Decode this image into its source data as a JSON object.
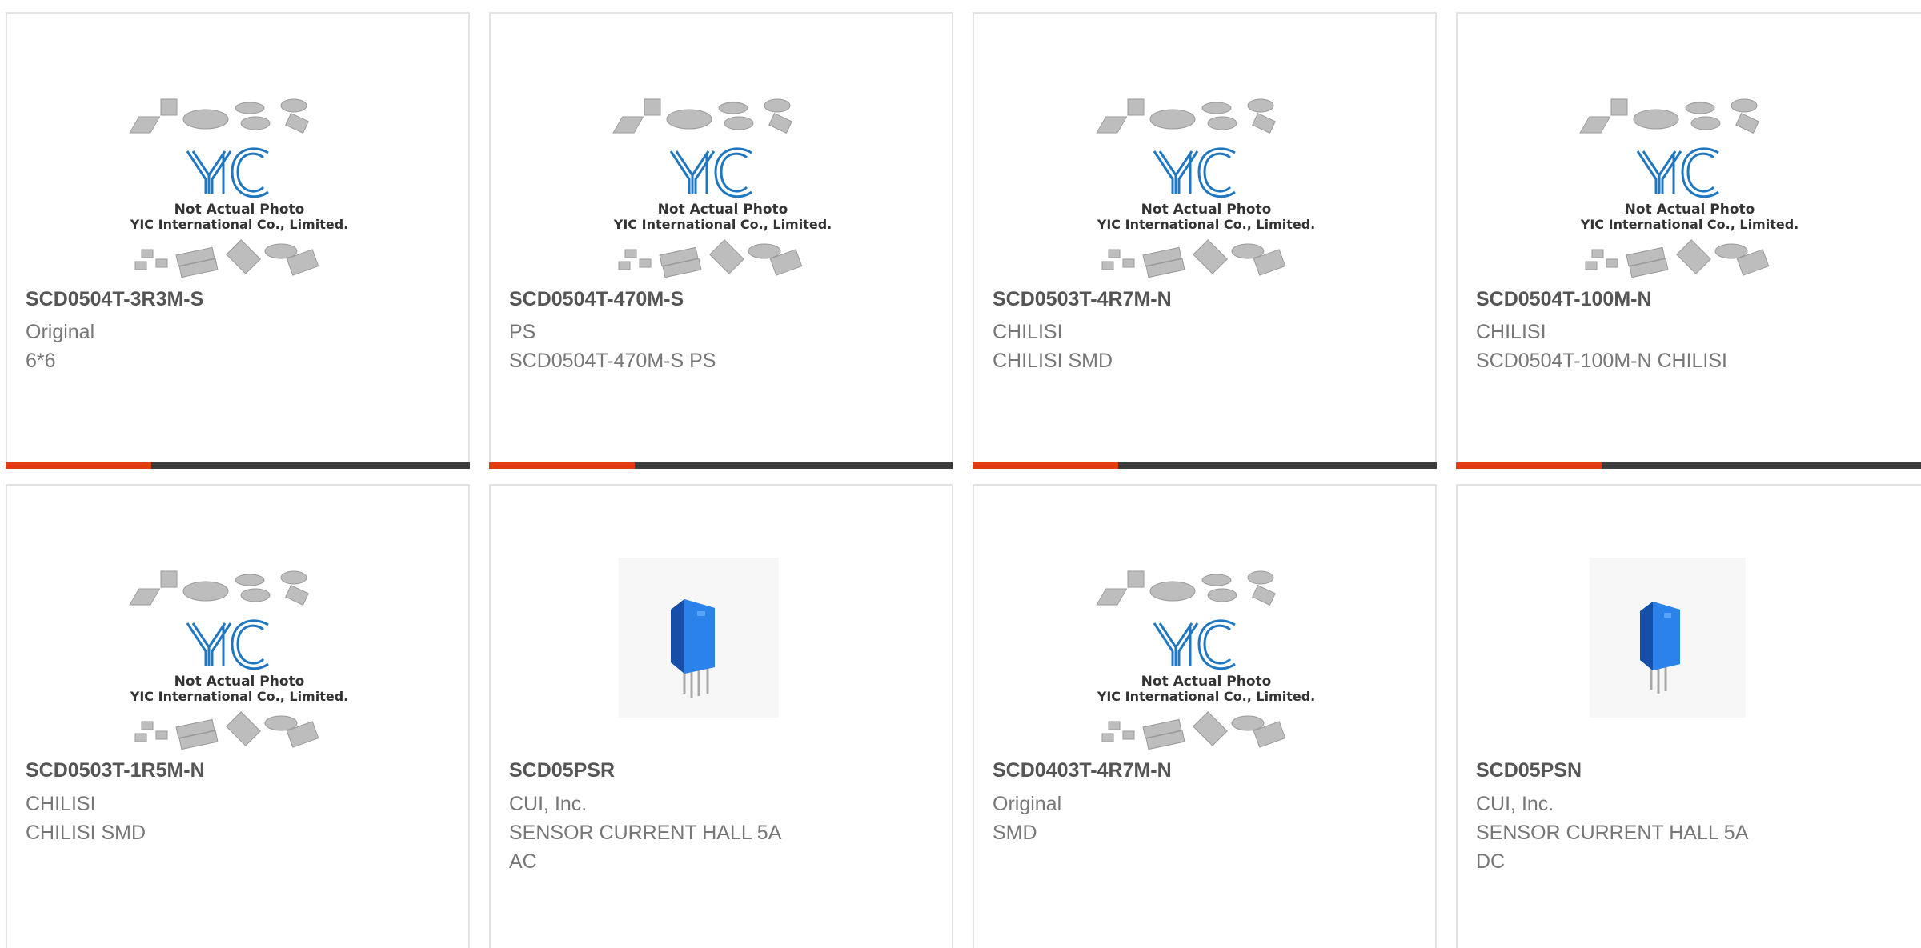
{
  "placeholder": {
    "line1": "Not Actual Photo",
    "line2": "YIC International Co., Limited."
  },
  "colors": {
    "accent_bar": "#e23c13",
    "dark_bar": "#3c3c3c",
    "logo_blue": "#1f77c2",
    "product_blue": "#1f6ed6"
  },
  "products": [
    {
      "part": "SCD0504T-3R3M-S",
      "brand": "Original",
      "desc": [
        "6*6"
      ],
      "image": "placeholder-logo-icon"
    },
    {
      "part": "SCD0504T-470M-S",
      "brand": "PS",
      "desc": [
        "SCD0504T-470M-S PS"
      ],
      "image": "placeholder-logo-icon"
    },
    {
      "part": "SCD0503T-4R7M-N",
      "brand": "CHILISI",
      "desc": [
        "CHILISI SMD"
      ],
      "image": "placeholder-logo-icon"
    },
    {
      "part": "SCD0504T-100M-N",
      "brand": "CHILISI",
      "desc": [
        "SCD0504T-100M-N CHILISI"
      ],
      "image": "placeholder-logo-icon"
    },
    {
      "part": "SCD0503T-1R5M-N",
      "brand": "CHILISI",
      "desc": [
        "CHILISI SMD"
      ],
      "image": "placeholder-logo-icon"
    },
    {
      "part": "SCD05PSR",
      "brand": "CUI, Inc.",
      "desc": [
        "SENSOR CURRENT HALL 5A",
        "AC"
      ],
      "image": "current-sensor-icon"
    },
    {
      "part": "SCD0403T-4R7M-N",
      "brand": "Original",
      "desc": [
        "SMD"
      ],
      "image": "placeholder-logo-icon"
    },
    {
      "part": "SCD05PSN",
      "brand": "CUI, Inc.",
      "desc": [
        "SENSOR CURRENT HALL 5A",
        "DC"
      ],
      "image": "current-sensor-icon"
    }
  ]
}
